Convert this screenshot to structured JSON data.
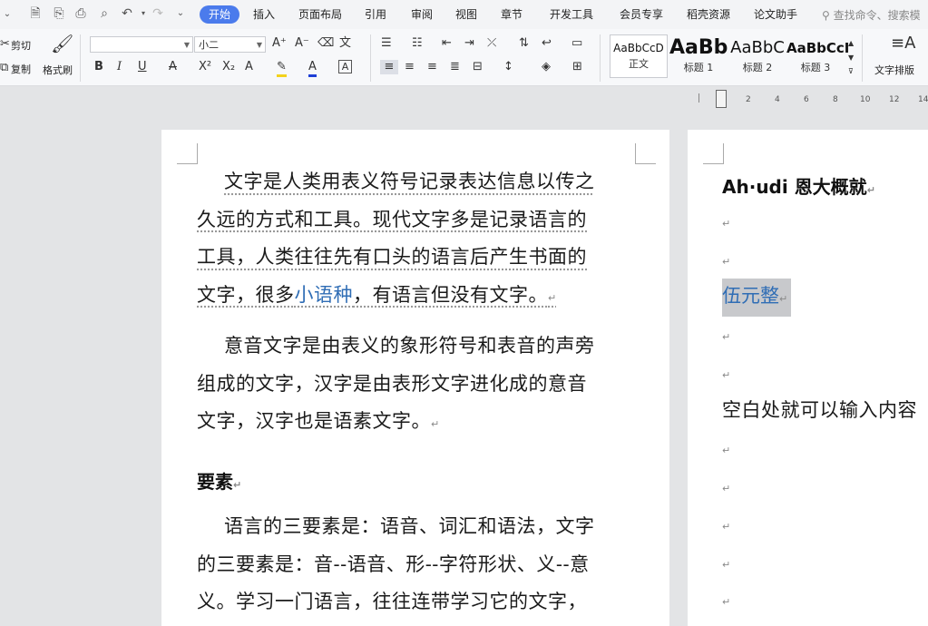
{
  "menubar": {
    "tabs": [
      {
        "label": "开始",
        "active": true
      },
      {
        "label": "插入"
      },
      {
        "label": "页面布局"
      },
      {
        "label": "引用"
      },
      {
        "label": "审阅"
      },
      {
        "label": "视图"
      },
      {
        "label": "章节"
      },
      {
        "label": "开发工具"
      },
      {
        "label": "会员专享"
      },
      {
        "label": "稻壳资源"
      },
      {
        "label": "论文助手"
      }
    ],
    "search_placeholder": "查找命令、搜索模"
  },
  "ribbon": {
    "cut_label": "剪切",
    "copy_label": "复制",
    "format_painter_label": "格式刷",
    "font_name": "",
    "font_size": "小二",
    "styles": [
      {
        "sample": "AaBbCcD",
        "name": "正文"
      },
      {
        "sample": "AaBb",
        "name": "标题 1"
      },
      {
        "sample": "AaBbC",
        "name": "标题 2"
      },
      {
        "sample": "AaBbCcI",
        "name": "标题 3"
      }
    ],
    "text_layout_label": "文字排版"
  },
  "ruler": {
    "ticks": [
      "2",
      "4",
      "6",
      "8",
      "10",
      "12",
      "14"
    ]
  },
  "page1": {
    "para1": {
      "line1": "文字是人类用表义符号记录表达信息以传之",
      "line2": "久远的方式和工具。现代文字多是记录语言的",
      "line3": "工具，人类往往先有口头的语言后产生书面的",
      "line4_a": "文字，很多",
      "line4_link": "小语种",
      "line4_b": "，有语言但没有文字。"
    },
    "para2": {
      "line1": "意音文字是由表义的象形符号和表音的声旁",
      "line2": "组成的文字，汉字是由表形文字进化成的意音",
      "line3": "文字，汉字也是语素文字。"
    },
    "heading": "要素",
    "para3": {
      "line1": "语言的三要素是：语音、词汇和语法，文字",
      "line2": "的三要素是：音--语音、形--字符形状、义--意",
      "line3": "义。学习一门语言，往往连带学习它的文字，"
    }
  },
  "page2": {
    "heading": "Ah·udi 恩大概就",
    "selected_text": "伍元整",
    "line_text": "空白处就可以输入内容"
  },
  "colors": {
    "accent": "#4b7bec",
    "link": "#2f6db5",
    "selection": "#c8c9cc"
  }
}
